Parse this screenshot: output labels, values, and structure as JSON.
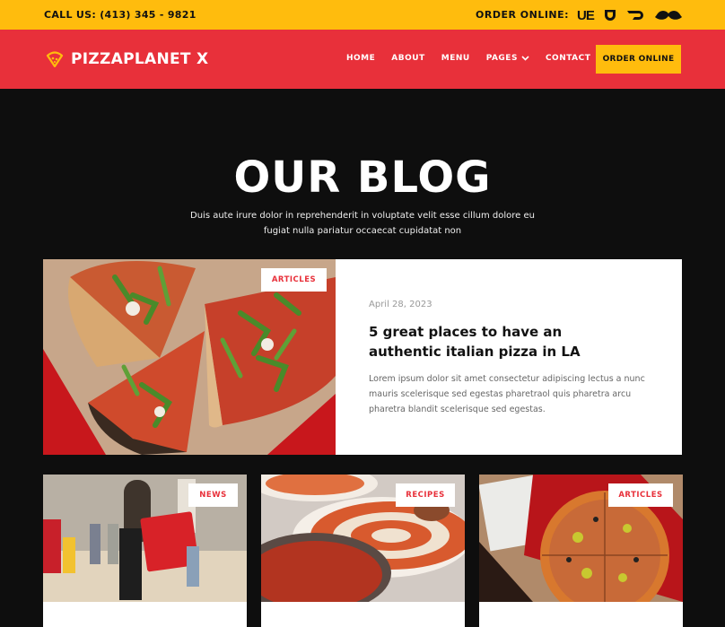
{
  "topbar": {
    "call_us": "CALL US: (413) 345 - 9821",
    "order_online_label": "ORDER ONLINE:",
    "delivery_services": [
      {
        "name": "ubereats-icon",
        "text": "UE"
      },
      {
        "name": "postmates-icon"
      },
      {
        "name": "doordash-icon"
      },
      {
        "name": "grubhub-icon"
      }
    ]
  },
  "header": {
    "logo_text": "PIZZAPLANET X",
    "nav": [
      {
        "label": "HOME"
      },
      {
        "label": "ABOUT"
      },
      {
        "label": "MENU"
      },
      {
        "label": "PAGES",
        "has_dropdown": true
      },
      {
        "label": "CONTACT"
      }
    ],
    "cta_label": "ORDER ONLINE"
  },
  "hero": {
    "title": "OUR BLOG",
    "subtitle": "Duis aute irure dolor in reprehenderit in voluptate velit esse cillum dolore eu fugiat nulla pariatur occaecat cupidatat non"
  },
  "featured_post": {
    "category": "ARTICLES",
    "date": "April 28, 2023",
    "title": "5 great places to have an authentic italian pizza in LA",
    "excerpt": "Lorem ipsum dolor sit amet consectetur adipiscing lectus a nunc mauris scelerisque sed egestas pharetraol quis pharetra arcu pharetra blandit  scelerisque sed egestas."
  },
  "posts": [
    {
      "category": "NEWS",
      "image": "delivery-bike-photo"
    },
    {
      "category": "RECIPES",
      "image": "pizza-sauce-photo"
    },
    {
      "category": "ARTICLES",
      "image": "pizza-top-view-photo"
    }
  ],
  "colors": {
    "yellow": "#ffbc0d",
    "red": "#e8303a",
    "dark": "#0e0e0e"
  }
}
